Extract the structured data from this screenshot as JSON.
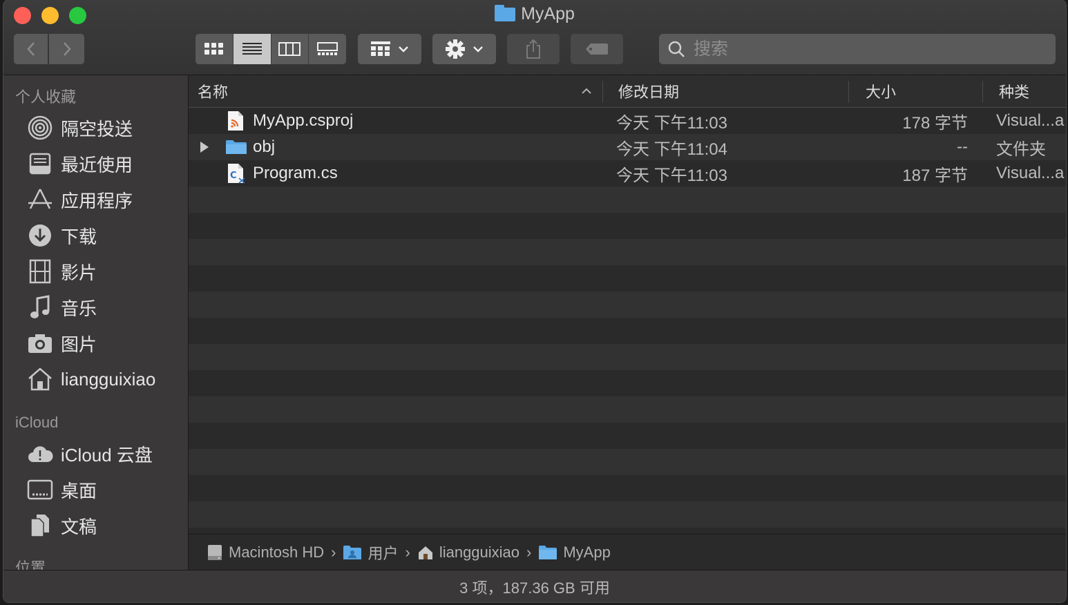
{
  "window": {
    "title": "MyApp"
  },
  "toolbar": {
    "back_icon": "chevron-left-icon",
    "forward_icon": "chevron-right-icon",
    "view_modes": [
      "icon-view",
      "list-view",
      "column-view",
      "gallery-view"
    ],
    "active_view": "list-view",
    "search_placeholder": "搜索"
  },
  "sidebar": {
    "favorites_header": "个人收藏",
    "favorites": [
      {
        "label": "隔空投送",
        "icon": "airdrop-icon"
      },
      {
        "label": "最近使用",
        "icon": "recents-icon"
      },
      {
        "label": "应用程序",
        "icon": "applications-icon"
      },
      {
        "label": "下载",
        "icon": "downloads-icon"
      },
      {
        "label": "影片",
        "icon": "movies-icon"
      },
      {
        "label": "音乐",
        "icon": "music-icon"
      },
      {
        "label": "图片",
        "icon": "pictures-icon"
      },
      {
        "label": "liangguixiao",
        "icon": "home-icon"
      }
    ],
    "icloud_header": "iCloud",
    "icloud": [
      {
        "label": "iCloud 云盘",
        "icon": "icloud-icon"
      },
      {
        "label": "桌面",
        "icon": "desktop-icon"
      },
      {
        "label": "文稿",
        "icon": "documents-icon"
      }
    ],
    "locations_header": "位置"
  },
  "columns": {
    "name": "名称",
    "modified": "修改日期",
    "size": "大小",
    "kind": "种类"
  },
  "files": [
    {
      "name": "MyApp.csproj",
      "modified": "今天 下午11:03",
      "size": "178 字节",
      "kind": "Visual...a",
      "icon": "csproj-file-icon"
    },
    {
      "name": "obj",
      "modified": "今天 下午11:04",
      "size": "--",
      "kind": "文件夹",
      "icon": "folder-icon"
    },
    {
      "name": "Program.cs",
      "modified": "今天 下午11:03",
      "size": "187 字节",
      "kind": "Visual...a",
      "icon": "csharp-file-icon"
    }
  ],
  "pathbar": [
    "Macintosh HD",
    "用户",
    "liangguixiao",
    "MyApp"
  ],
  "status": "3 项，187.36 GB 可用",
  "colors": {
    "folder": "#5aa8e6",
    "window_bg": "#2b2a2a",
    "sidebar_bg": "#3a3838"
  }
}
